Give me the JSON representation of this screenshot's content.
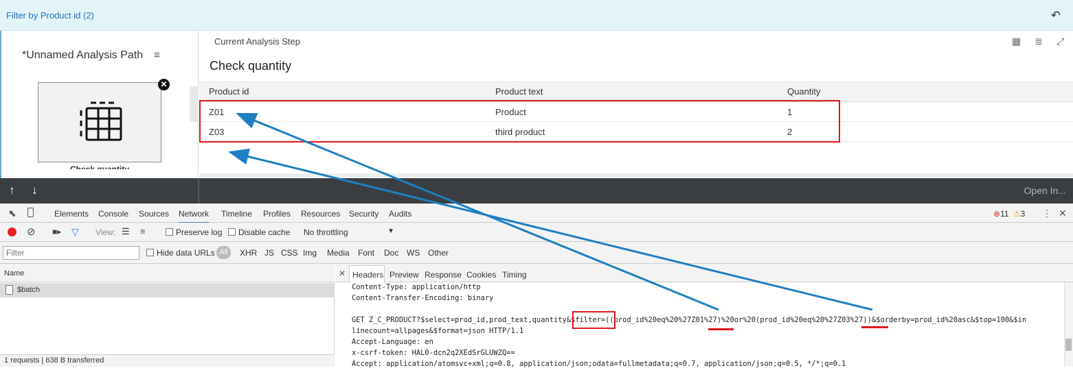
{
  "filterbar": {
    "title": "Filter by Product id (2)",
    "undo_icon": "undo-icon"
  },
  "left": {
    "path_title": "*Unnamed Analysis Path",
    "step_label": "Check quantity"
  },
  "main": {
    "step_header": "Current Analysis Step",
    "heading": "Check quantity",
    "table": {
      "columns": [
        "Product id",
        "Product text",
        "Quantity"
      ],
      "rows": [
        [
          "Z01",
          "Product",
          "1"
        ],
        [
          "Z03",
          "third product",
          "2"
        ]
      ]
    }
  },
  "darkbar": {
    "open_in": "Open In..."
  },
  "devtools": {
    "tabs": [
      "Elements",
      "Console",
      "Sources",
      "Network",
      "Timeline",
      "Profiles",
      "Resources",
      "Security",
      "Audits"
    ],
    "errors": "11",
    "warnings": "3",
    "toolbar": {
      "view_label": "View:",
      "preserve_log": "Preserve log",
      "disable_cache": "Disable cache",
      "throttling": "No throttling"
    },
    "filter": {
      "placeholder": "Filter",
      "hide_data_urls": "Hide data URLs",
      "all": "All",
      "types": [
        "XHR",
        "JS",
        "CSS",
        "Img",
        "Media",
        "Font",
        "Doc",
        "WS",
        "Other"
      ]
    },
    "name_col": "Name",
    "request_name": "$batch",
    "status": "1 requests  |  638 B transferred",
    "detail_tabs": [
      "Headers",
      "Preview",
      "Response",
      "Cookies",
      "Timing"
    ],
    "code_lines": [
      "Content-Type: application/http",
      "Content-Transfer-Encoding: binary",
      "",
      "GET Z_C_PRODUCT?$select=prod_id,prod_text,quantity&$filter=((prod_id%20eq%20%27Z01%27)%20or%20(prod_id%20eq%20%27Z03%27))&$orderby=prod_id%20asc&$top=100&$in",
      "linecount=allpages&$format=json HTTP/1.1",
      "Accept-Language: en",
      "x-csrf-token: HAL0-dcn2q2XEdSrGLUWZQ==",
      "Accept: application/atomsvc+xml;q=0.8, application/json;odata=fullmetadata;q=0.7, application/json;q=0.5, */*;q=0.1"
    ]
  }
}
